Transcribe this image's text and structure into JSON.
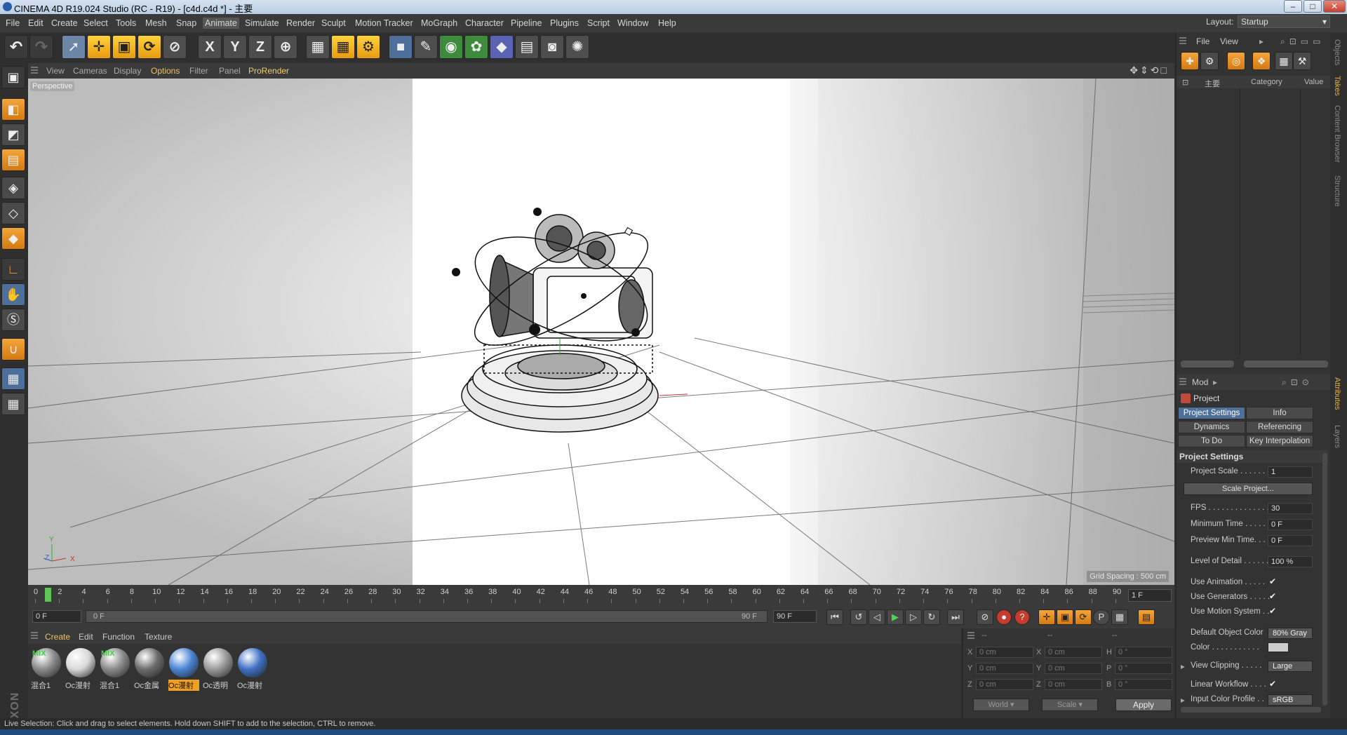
{
  "window": {
    "title": "CINEMA 4D R19.024 Studio (RC - R19) - [c4d.c4d *] - 主要",
    "controls": [
      "–",
      "□",
      "✕"
    ]
  },
  "menu": {
    "items": [
      "File",
      "Edit",
      "Create",
      "Select",
      "Tools",
      "Mesh",
      "Snap",
      "Animate",
      "Simulate",
      "Render",
      "Sculpt",
      "Motion Tracker",
      "MoGraph",
      "Character",
      "Pipeline",
      "Plugins",
      "Script",
      "Window",
      "Help"
    ],
    "layout_label": "Layout:",
    "layout_value": "Startup"
  },
  "toolbar": {
    "axis_x": "X",
    "axis_y": "Y",
    "axis_z": "Z"
  },
  "viewport": {
    "menu": [
      "View",
      "Cameras",
      "Display",
      "Options",
      "Filter",
      "Panel",
      "ProRender"
    ],
    "camera_label": "Perspective",
    "grid_spacing": "Grid Spacing : 500 cm",
    "axis_labels": {
      "y": "Y",
      "z": "Z",
      "x": "X"
    }
  },
  "timeline": {
    "ticks": [
      "0",
      "2",
      "4",
      "6",
      "8",
      "10",
      "12",
      "14",
      "16",
      "18",
      "20",
      "22",
      "24",
      "26",
      "28",
      "30",
      "32",
      "34",
      "36",
      "38",
      "40",
      "42",
      "44",
      "46",
      "48",
      "50",
      "52",
      "54",
      "56",
      "58",
      "60",
      "62",
      "64",
      "66",
      "68",
      "70",
      "72",
      "74",
      "76",
      "78",
      "80",
      "82",
      "84",
      "86",
      "88",
      "90"
    ],
    "current_frame": "1 F",
    "start_field": "0 F",
    "range_start": "0 F",
    "range_end": "90 F",
    "end_field": "90 F"
  },
  "materials": {
    "menu": [
      "Create",
      "Edit",
      "Function",
      "Texture"
    ],
    "items": [
      {
        "label": "混合1",
        "mix": "MIX",
        "color": "#8a8a8a",
        "selected": false
      },
      {
        "label": "Oc漫射",
        "mix": "",
        "color": "#d8d8d8",
        "selected": false
      },
      {
        "label": "混合1",
        "mix": "MIX",
        "color": "#8a8a8a",
        "selected": false
      },
      {
        "label": "Oc金属",
        "mix": "",
        "color": "#6c6c6c",
        "selected": false
      },
      {
        "label": "Oc漫射",
        "mix": "",
        "color": "#4a84d6",
        "selected": true
      },
      {
        "label": "Oc透明",
        "mix": "",
        "color": "#9a9a9a",
        "selected": false
      },
      {
        "label": "Oc漫射",
        "mix": "",
        "color": "#3f70c4",
        "selected": false
      }
    ]
  },
  "coordinates": {
    "header": [
      "--",
      "--",
      "--"
    ],
    "rows": [
      {
        "a": "X",
        "av": "0 cm",
        "b": "X",
        "bv": "0 cm",
        "c": "H",
        "cv": "0 °"
      },
      {
        "a": "Y",
        "av": "0 cm",
        "b": "Y",
        "bv": "0 cm",
        "c": "P",
        "cv": "0 °"
      },
      {
        "a": "Z",
        "av": "0 cm",
        "b": "Z",
        "bv": "0 cm",
        "c": "B",
        "cv": "0 °"
      }
    ],
    "mode": "World",
    "size_mode": "Scale",
    "apply": "Apply"
  },
  "status": "Live Selection: Click and drag to select elements. Hold down SHIFT to add to the selection, CTRL to remove.",
  "objects_panel": {
    "menu": [
      "File",
      "View"
    ],
    "columns": [
      "主要",
      "Category",
      "Value"
    ],
    "side_tabs": [
      "Objects",
      "Takes",
      "Content Browser",
      "Structure"
    ]
  },
  "attributes": {
    "mode_label": "Mod",
    "object": "Project",
    "tabs": [
      "Project Settings",
      "Info",
      "Dynamics",
      "Referencing",
      "To Do",
      "Key Interpolation"
    ],
    "section": "Project Settings",
    "scale_button": "Scale Project...",
    "rows": {
      "project_scale": {
        "label": "Project Scale . . . . . . .",
        "value": "1"
      },
      "fps": {
        "label": "FPS . . . . . . . . . . . . . .",
        "value": "30"
      },
      "min_time": {
        "label": "Minimum Time . . . . .",
        "value": "0 F"
      },
      "preview_min": {
        "label": "Preview Min Time. . .",
        "value": "0 F"
      },
      "lod": {
        "label": "Level of Detail . . . . . .",
        "value": "100 %"
      },
      "use_anim": {
        "label": "Use Animation . . . . .",
        "value": "✔"
      },
      "use_gen": {
        "label": "Use Generators . . . . .",
        "value": "✔"
      },
      "use_motion": {
        "label": "Use Motion System . .",
        "value": "✔"
      },
      "def_color": {
        "label": "Default Object Color",
        "value": "80% Gray"
      },
      "color": {
        "label": "Color . . . . . . . . . . ."
      },
      "view_clip": {
        "label": "View Clipping . . . . .",
        "value": "Large"
      },
      "linear": {
        "label": "Linear Workflow . . . .",
        "value": "✔"
      },
      "input_profile": {
        "label": "Input Color Profile . .",
        "value": "sRGB"
      }
    },
    "side_tabs": [
      "Attributes",
      "Layers"
    ]
  }
}
